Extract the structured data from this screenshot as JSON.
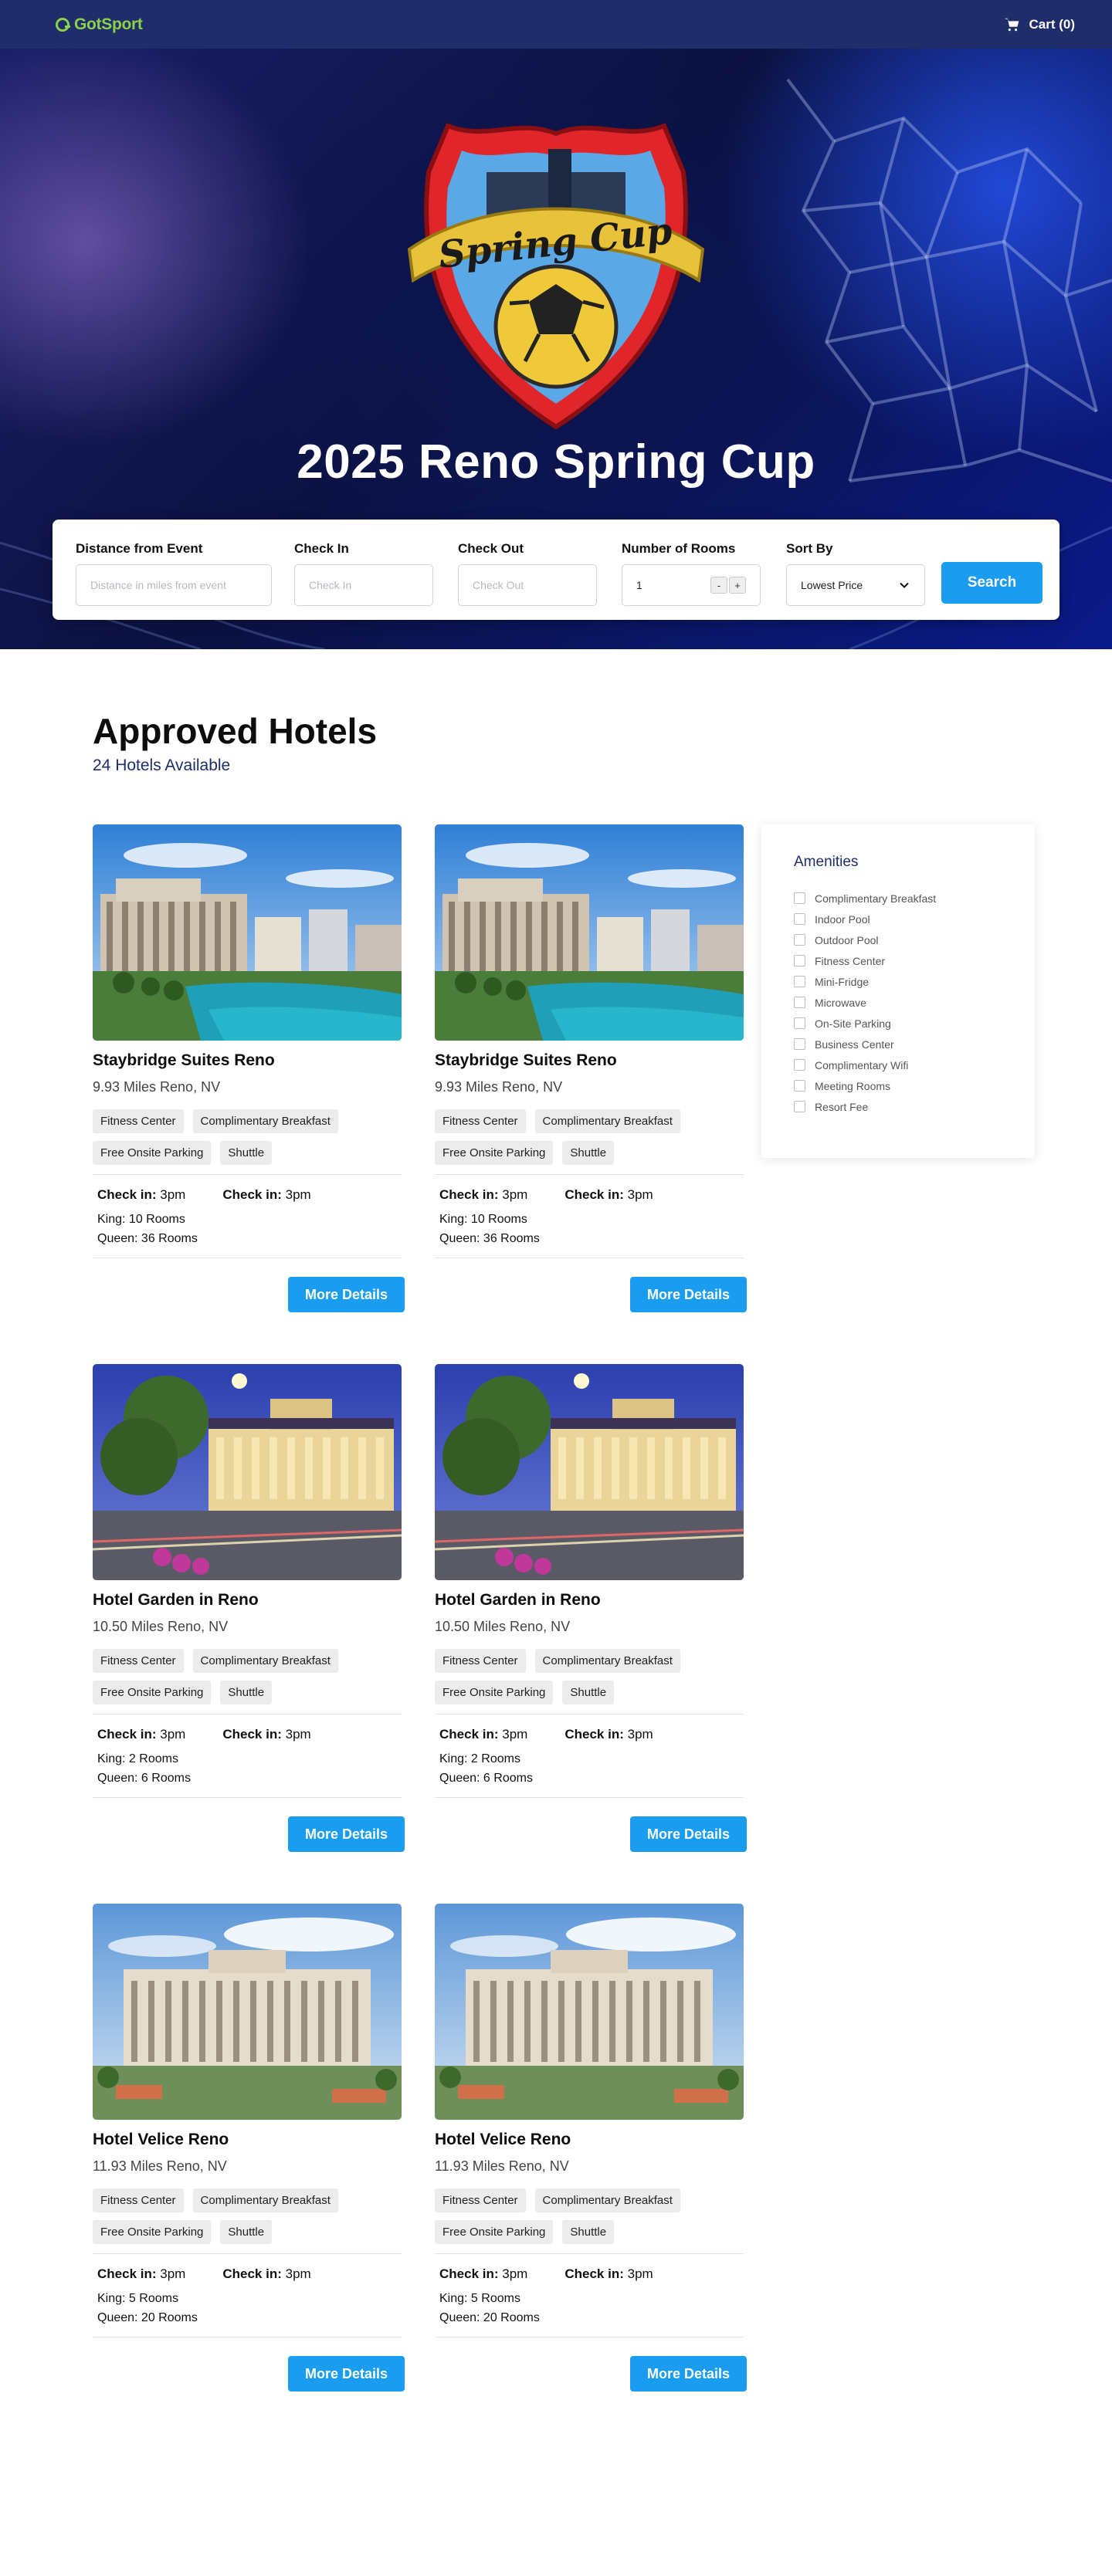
{
  "header": {
    "logo_text": "GotSport",
    "cart_label": "Cart (0)"
  },
  "hero": {
    "title": "2025 Reno Spring Cup",
    "crest_text": "Spring Cup"
  },
  "search": {
    "distance": {
      "label": "Distance from Event",
      "placeholder": "Distance in miles from event"
    },
    "check_in": {
      "label": "Check In",
      "placeholder": "Check In"
    },
    "check_out": {
      "label": "Check Out",
      "placeholder": "Check Out"
    },
    "rooms": {
      "label": "Number of Rooms",
      "value": "1",
      "minus": "-",
      "plus": "+"
    },
    "sort": {
      "label": "Sort By",
      "value": "Lowest Price"
    },
    "search_button": "Search"
  },
  "section": {
    "title": "Approved Hotels",
    "subtitle": "24 Hotels Available"
  },
  "hotels": [
    {
      "name": "Staybridge Suites Reno",
      "distance": "9.93 Miles Reno, NV",
      "tags": [
        "Fitness Center",
        "Complimentary Breakfast",
        "Free Onsite Parking",
        "Shuttle"
      ],
      "checkin_label": "Check in:",
      "checkin": "3pm",
      "checkin2_label": "Check in:",
      "checkin2": "3pm",
      "king": "King: 10 Rooms",
      "queen": "Queen: 36 Rooms",
      "button": "More Details",
      "image": "pool-hotel"
    },
    {
      "name": "Staybridge Suites Reno",
      "distance": "9.93 Miles Reno, NV",
      "tags": [
        "Fitness Center",
        "Complimentary Breakfast",
        "Free Onsite Parking",
        "Shuttle"
      ],
      "checkin_label": "Check in:",
      "checkin": "3pm",
      "checkin2_label": "Check in:",
      "checkin2": "3pm",
      "king": "King: 10 Rooms",
      "queen": "Queen: 36 Rooms",
      "button": "More Details",
      "image": "pool-hotel"
    },
    {
      "name": "Hotel Garden in Reno",
      "distance": "10.50 Miles Reno, NV",
      "tags": [
        "Fitness Center",
        "Complimentary Breakfast",
        "Free Onsite Parking",
        "Shuttle"
      ],
      "checkin_label": "Check in:",
      "checkin": "3pm",
      "checkin2_label": "Check in:",
      "checkin2": "3pm",
      "king": "King: 2 Rooms",
      "queen": "Queen: 6 Rooms",
      "button": "More Details",
      "image": "night-hotel"
    },
    {
      "name": "Hotel Garden in Reno",
      "distance": "10.50 Miles Reno, NV",
      "tags": [
        "Fitness Center",
        "Complimentary Breakfast",
        "Free Onsite Parking",
        "Shuttle"
      ],
      "checkin_label": "Check in:",
      "checkin": "3pm",
      "checkin2_label": "Check in:",
      "checkin2": "3pm",
      "king": "King: 2 Rooms",
      "queen": "Queen: 6 Rooms",
      "button": "More Details",
      "image": "night-hotel"
    },
    {
      "name": "Hotel Velice Reno",
      "distance": "11.93 Miles Reno, NV",
      "tags": [
        "Fitness Center",
        "Complimentary Breakfast",
        "Free Onsite Parking",
        "Shuttle"
      ],
      "checkin_label": "Check in:",
      "checkin": "3pm",
      "checkin2_label": "Check in:",
      "checkin2": "3pm",
      "king": "King: 5 Rooms",
      "queen": "Queen: 20 Rooms",
      "button": "More Details",
      "image": "day-hotel"
    },
    {
      "name": "Hotel Velice Reno",
      "distance": "11.93 Miles Reno, NV",
      "tags": [
        "Fitness Center",
        "Complimentary Breakfast",
        "Free Onsite Parking",
        "Shuttle"
      ],
      "checkin_label": "Check in:",
      "checkin": "3pm",
      "checkin2_label": "Check in:",
      "checkin2": "3pm",
      "king": "King: 5 Rooms",
      "queen": "Queen: 20 Rooms",
      "button": "More Details",
      "image": "day-hotel"
    }
  ],
  "amenities": {
    "title": "Amenities",
    "items": [
      "Complimentary Breakfast",
      "Indoor Pool",
      "Outdoor Pool",
      "Fitness Center",
      "Mini-Fridge",
      "Microwave",
      "On-Site Parking",
      "Business Center",
      "Complimentary Wifi",
      "Meeting Rooms",
      "Resort Fee"
    ]
  },
  "colors": {
    "header_bg": "#1f2d6b",
    "accent": "#1a9cf0",
    "logo_green": "#8bd14a"
  }
}
